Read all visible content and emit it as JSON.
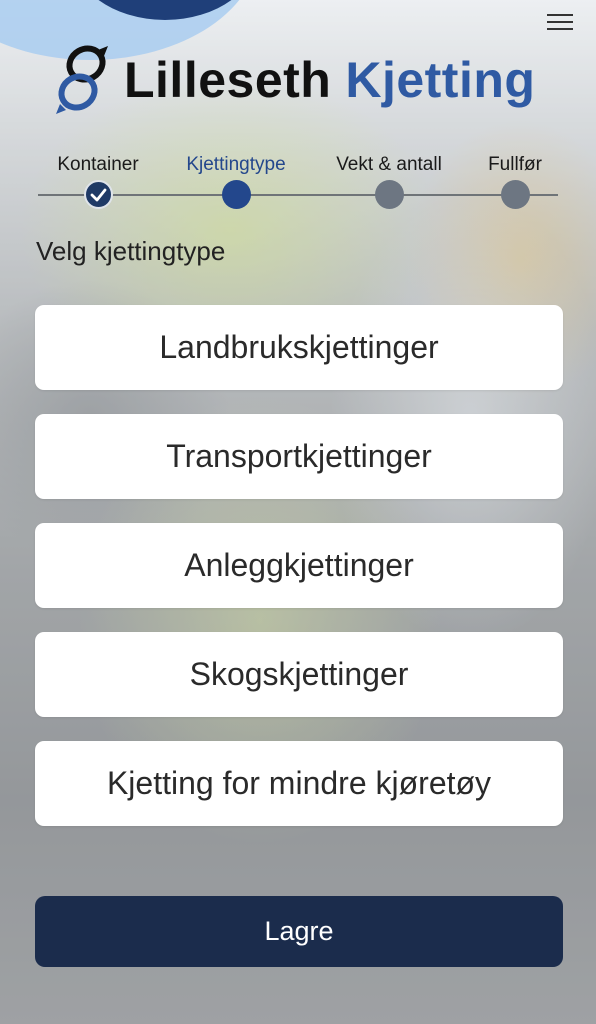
{
  "header": {
    "brand_word1": "Lilleseth",
    "brand_word2": "Kjetting",
    "brand_color": "#2f5aa3"
  },
  "stepper": {
    "steps": [
      {
        "label": "Kontainer",
        "state": "done"
      },
      {
        "label": "Kjettingtype",
        "state": "active"
      },
      {
        "label": "Vekt & antall",
        "state": "pending"
      },
      {
        "label": "Fullfør",
        "state": "pending"
      }
    ],
    "active_color": "#23478c"
  },
  "main": {
    "title": "Velg kjettingtype",
    "options": [
      "Landbrukskjettinger",
      "Transportkjettinger",
      "Anleggkjettinger",
      "Skogskjettinger",
      "Kjetting for mindre kjøretøy"
    ]
  },
  "footer": {
    "save_label": "Lagre",
    "save_color": "#1b2c4c"
  }
}
